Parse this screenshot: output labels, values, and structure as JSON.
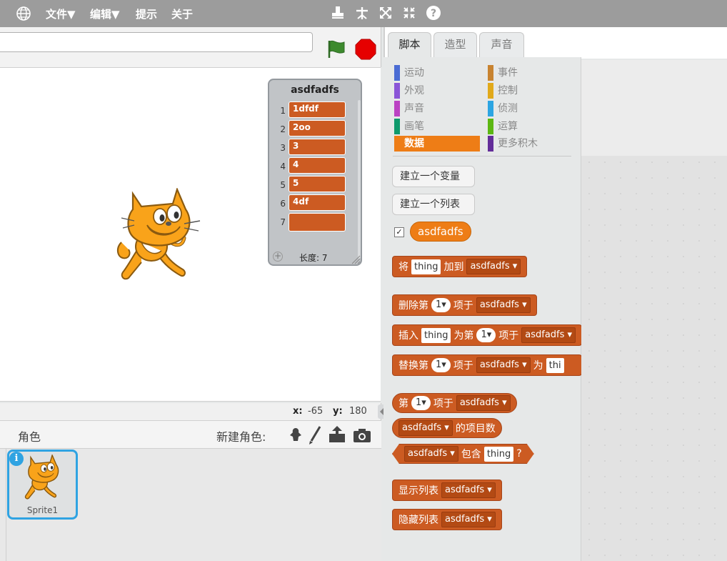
{
  "menu": {
    "items": [
      "文件▼",
      "编辑▼",
      "提示",
      "关于"
    ],
    "tool_icons": [
      "stamp-icon",
      "shrink-icon",
      "grow-icon",
      "fullscreen-icon",
      "help-icon"
    ]
  },
  "stage": {
    "coords_x_label": "x:",
    "coords_x_value": "-65",
    "coords_y_label": "y:",
    "coords_y_value": "180"
  },
  "list_monitor": {
    "title": "asdfadfs",
    "items": [
      {
        "index": "1",
        "value": "1dfdf"
      },
      {
        "index": "2",
        "value": "2oo"
      },
      {
        "index": "3",
        "value": "3"
      },
      {
        "index": "4",
        "value": "4"
      },
      {
        "index": "5",
        "value": "5"
      },
      {
        "index": "6",
        "value": "4df"
      },
      {
        "index": "7",
        "value": ""
      }
    ],
    "add_symbol": "+",
    "length_label": "长度: 7"
  },
  "sprites": {
    "header_label": "角色",
    "new_sprite_label": "新建角色:",
    "sprite_name": "Sprite1",
    "info_symbol": "i"
  },
  "tabs": [
    "脚本",
    "造型",
    "声音"
  ],
  "categories": [
    {
      "label": "运动",
      "color": "#4a6cd4"
    },
    {
      "label": "事件",
      "color": "#c88330"
    },
    {
      "label": "外观",
      "color": "#8a55d7"
    },
    {
      "label": "控制",
      "color": "#e1a91a"
    },
    {
      "label": "声音",
      "color": "#bb42c3"
    },
    {
      "label": "侦测",
      "color": "#2ca5e2"
    },
    {
      "label": "画笔",
      "color": "#0e9a6c"
    },
    {
      "label": "运算",
      "color": "#5cb712"
    },
    {
      "label": "数据",
      "color": "#ee7d16"
    },
    {
      "label": "更多积木",
      "color": "#632d99"
    }
  ],
  "palette": {
    "make_variable": "建立一个变量",
    "make_list": "建立一个列表",
    "list_reporter": "asdfadfs",
    "checkbox_mark": "✓"
  },
  "blocks": {
    "add": {
      "pre": "将",
      "slot": "thing",
      "mid": "加到",
      "dd": "asdfadfs"
    },
    "delete": {
      "pre": "删除第",
      "num": "1",
      "mid": "项于",
      "dd": "asdfadfs"
    },
    "insert": {
      "pre": "插入",
      "slot": "thing",
      "mid": "为第",
      "num": "1",
      "mid2": "项于",
      "dd": "asdfadfs"
    },
    "replace": {
      "pre": "替换第",
      "num": "1",
      "mid": "项于",
      "dd": "asdfadfs",
      "mid2": "为",
      "slot": "thi"
    },
    "item": {
      "pre": "第",
      "num": "1",
      "mid": "项于",
      "dd": "asdfadfs"
    },
    "length": {
      "dd": "asdfadfs",
      "post": "的项目数"
    },
    "contains": {
      "dd": "asdfadfs",
      "mid": "包含",
      "slot": "thing",
      "post": "?"
    },
    "show": {
      "pre": "显示列表",
      "dd": "asdfadfs"
    },
    "hide": {
      "pre": "隐藏列表",
      "dd": "asdfadfs"
    }
  },
  "colors": {
    "data_block": "#cc5b22",
    "data_category": "#ee7d16",
    "menubar": "#9c9c9c",
    "stop_red": "#e60000",
    "flag_green": "#3d8a2e"
  }
}
